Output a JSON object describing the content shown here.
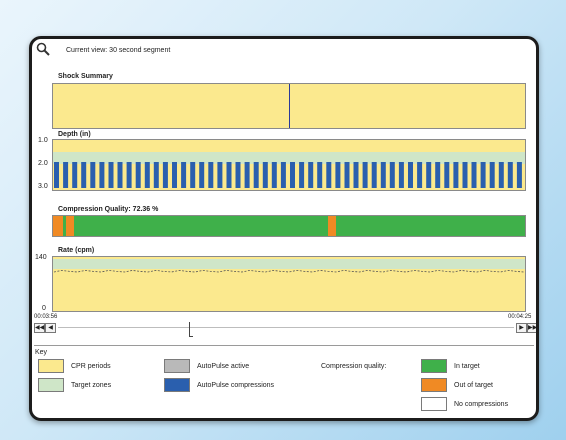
{
  "header": {
    "title": "Current view: 30 second segment"
  },
  "shock": {
    "title": "Shock Summary"
  },
  "depth": {
    "title": "Depth (in)",
    "ticks": [
      "1.0",
      "2.0",
      "3.0"
    ]
  },
  "quality": {
    "title": "Compression Quality: 72.36 %"
  },
  "rate": {
    "title": "Rate (cpm)",
    "ticks": [
      "140",
      "0"
    ]
  },
  "timeline": {
    "start": "00:03:56",
    "end": "00:04:25"
  },
  "key": {
    "title": "Key",
    "cpr_periods": "CPR periods",
    "target_zones": "Target zones",
    "autopulse_active": "AutoPulse active",
    "autopulse_compressions": "AutoPulse compressions",
    "compression_quality": "Compression quality:",
    "in_target": "In target",
    "out_of_target": "Out of target",
    "no_compressions": "No compressions"
  },
  "colors": {
    "cpr": "#fbe98e",
    "target": "#cfe6c8",
    "autopulse_active": "#b9b9b9",
    "autopulse_compressions": "#2a5fae",
    "in_target": "#3fb04a",
    "out_of_target": "#f08a24",
    "no_compressions": "#ffffff"
  },
  "icons": {
    "zoom": "magnifier-icon"
  }
}
